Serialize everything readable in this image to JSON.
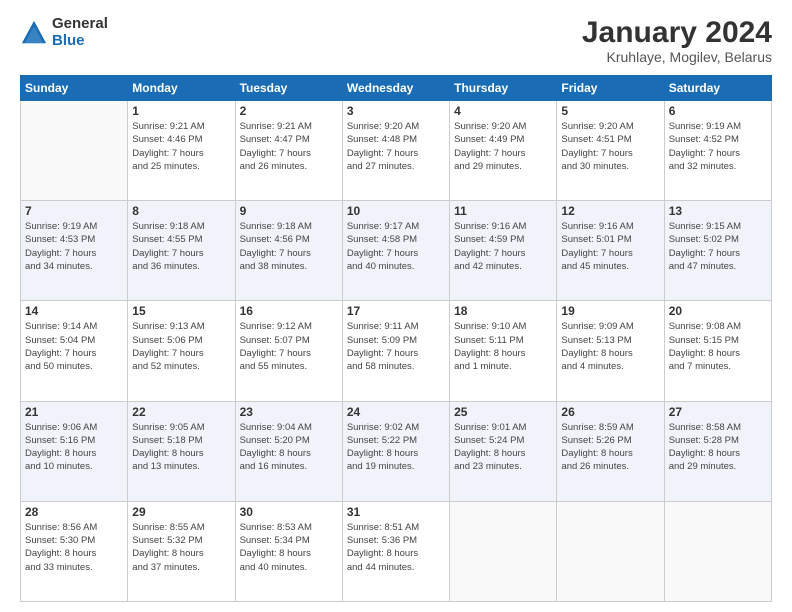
{
  "logo": {
    "general": "General",
    "blue": "Blue"
  },
  "title": "January 2024",
  "subtitle": "Kruhlaye, Mogilev, Belarus",
  "days_header": [
    "Sunday",
    "Monday",
    "Tuesday",
    "Wednesday",
    "Thursday",
    "Friday",
    "Saturday"
  ],
  "weeks": [
    [
      {
        "day": "",
        "info": ""
      },
      {
        "day": "1",
        "info": "Sunrise: 9:21 AM\nSunset: 4:46 PM\nDaylight: 7 hours\nand 25 minutes."
      },
      {
        "day": "2",
        "info": "Sunrise: 9:21 AM\nSunset: 4:47 PM\nDaylight: 7 hours\nand 26 minutes."
      },
      {
        "day": "3",
        "info": "Sunrise: 9:20 AM\nSunset: 4:48 PM\nDaylight: 7 hours\nand 27 minutes."
      },
      {
        "day": "4",
        "info": "Sunrise: 9:20 AM\nSunset: 4:49 PM\nDaylight: 7 hours\nand 29 minutes."
      },
      {
        "day": "5",
        "info": "Sunrise: 9:20 AM\nSunset: 4:51 PM\nDaylight: 7 hours\nand 30 minutes."
      },
      {
        "day": "6",
        "info": "Sunrise: 9:19 AM\nSunset: 4:52 PM\nDaylight: 7 hours\nand 32 minutes."
      }
    ],
    [
      {
        "day": "7",
        "info": "Sunrise: 9:19 AM\nSunset: 4:53 PM\nDaylight: 7 hours\nand 34 minutes."
      },
      {
        "day": "8",
        "info": "Sunrise: 9:18 AM\nSunset: 4:55 PM\nDaylight: 7 hours\nand 36 minutes."
      },
      {
        "day": "9",
        "info": "Sunrise: 9:18 AM\nSunset: 4:56 PM\nDaylight: 7 hours\nand 38 minutes."
      },
      {
        "day": "10",
        "info": "Sunrise: 9:17 AM\nSunset: 4:58 PM\nDaylight: 7 hours\nand 40 minutes."
      },
      {
        "day": "11",
        "info": "Sunrise: 9:16 AM\nSunset: 4:59 PM\nDaylight: 7 hours\nand 42 minutes."
      },
      {
        "day": "12",
        "info": "Sunrise: 9:16 AM\nSunset: 5:01 PM\nDaylight: 7 hours\nand 45 minutes."
      },
      {
        "day": "13",
        "info": "Sunrise: 9:15 AM\nSunset: 5:02 PM\nDaylight: 7 hours\nand 47 minutes."
      }
    ],
    [
      {
        "day": "14",
        "info": "Sunrise: 9:14 AM\nSunset: 5:04 PM\nDaylight: 7 hours\nand 50 minutes."
      },
      {
        "day": "15",
        "info": "Sunrise: 9:13 AM\nSunset: 5:06 PM\nDaylight: 7 hours\nand 52 minutes."
      },
      {
        "day": "16",
        "info": "Sunrise: 9:12 AM\nSunset: 5:07 PM\nDaylight: 7 hours\nand 55 minutes."
      },
      {
        "day": "17",
        "info": "Sunrise: 9:11 AM\nSunset: 5:09 PM\nDaylight: 7 hours\nand 58 minutes."
      },
      {
        "day": "18",
        "info": "Sunrise: 9:10 AM\nSunset: 5:11 PM\nDaylight: 8 hours\nand 1 minute."
      },
      {
        "day": "19",
        "info": "Sunrise: 9:09 AM\nSunset: 5:13 PM\nDaylight: 8 hours\nand 4 minutes."
      },
      {
        "day": "20",
        "info": "Sunrise: 9:08 AM\nSunset: 5:15 PM\nDaylight: 8 hours\nand 7 minutes."
      }
    ],
    [
      {
        "day": "21",
        "info": "Sunrise: 9:06 AM\nSunset: 5:16 PM\nDaylight: 8 hours\nand 10 minutes."
      },
      {
        "day": "22",
        "info": "Sunrise: 9:05 AM\nSunset: 5:18 PM\nDaylight: 8 hours\nand 13 minutes."
      },
      {
        "day": "23",
        "info": "Sunrise: 9:04 AM\nSunset: 5:20 PM\nDaylight: 8 hours\nand 16 minutes."
      },
      {
        "day": "24",
        "info": "Sunrise: 9:02 AM\nSunset: 5:22 PM\nDaylight: 8 hours\nand 19 minutes."
      },
      {
        "day": "25",
        "info": "Sunrise: 9:01 AM\nSunset: 5:24 PM\nDaylight: 8 hours\nand 23 minutes."
      },
      {
        "day": "26",
        "info": "Sunrise: 8:59 AM\nSunset: 5:26 PM\nDaylight: 8 hours\nand 26 minutes."
      },
      {
        "day": "27",
        "info": "Sunrise: 8:58 AM\nSunset: 5:28 PM\nDaylight: 8 hours\nand 29 minutes."
      }
    ],
    [
      {
        "day": "28",
        "info": "Sunrise: 8:56 AM\nSunset: 5:30 PM\nDaylight: 8 hours\nand 33 minutes."
      },
      {
        "day": "29",
        "info": "Sunrise: 8:55 AM\nSunset: 5:32 PM\nDaylight: 8 hours\nand 37 minutes."
      },
      {
        "day": "30",
        "info": "Sunrise: 8:53 AM\nSunset: 5:34 PM\nDaylight: 8 hours\nand 40 minutes."
      },
      {
        "day": "31",
        "info": "Sunrise: 8:51 AM\nSunset: 5:36 PM\nDaylight: 8 hours\nand 44 minutes."
      },
      {
        "day": "",
        "info": ""
      },
      {
        "day": "",
        "info": ""
      },
      {
        "day": "",
        "info": ""
      }
    ]
  ]
}
